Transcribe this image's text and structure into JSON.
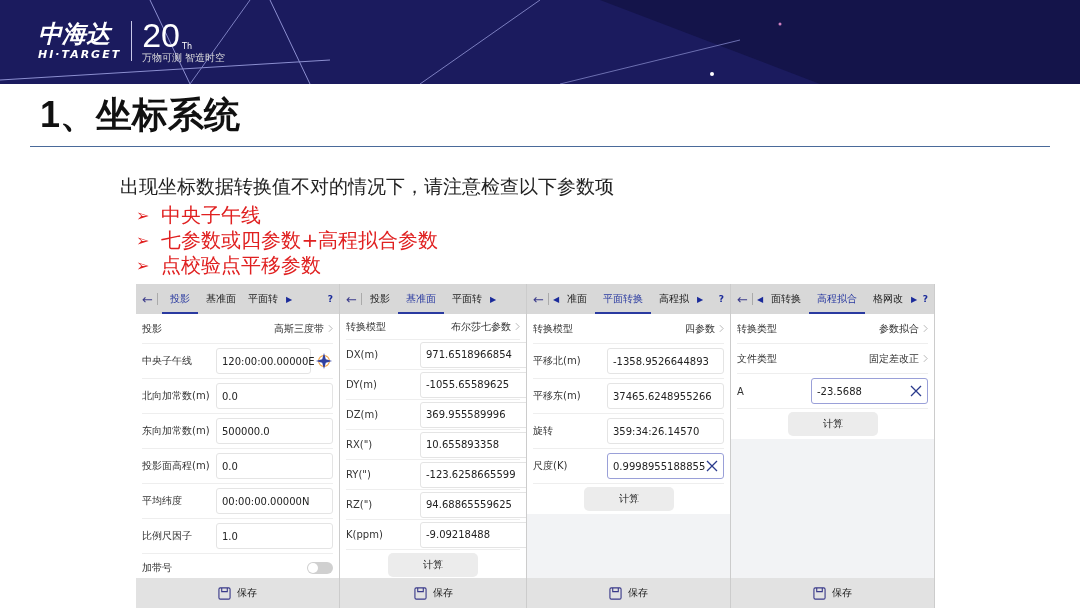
{
  "header": {
    "logo_cn": "中海达",
    "logo_en": "HI·TARGET",
    "anniversary": "20",
    "anniversary_suffix": "Th",
    "slogan": "万物可测 智造时空"
  },
  "title": "1、坐标系统",
  "intro": "出现坐标数据转换值不对的情况下，请注意检查以下参数项",
  "bullets": [
    {
      "marker": "➢",
      "text": "中央子午线"
    },
    {
      "marker": "➢",
      "text": "七参数或四参数+高程拟合参数"
    },
    {
      "marker": "➢",
      "text": "点校验点平移参数"
    }
  ],
  "screens": [
    {
      "back": "←",
      "tabs": [
        {
          "label": "投影",
          "selected": true
        },
        {
          "label": "基准面",
          "selected": false
        },
        {
          "label": "平面转",
          "selected": false
        }
      ],
      "next": "▶",
      "help": "?",
      "rows": [
        {
          "kind": "select",
          "label": "投影",
          "value": "高斯三度带"
        },
        {
          "kind": "field",
          "label": "中央子午线",
          "value": "120:00:00.00000E",
          "focused": false,
          "locate": true
        },
        {
          "kind": "field",
          "label": "北向加常数(m)",
          "value": "0.0",
          "focused": false
        },
        {
          "kind": "field",
          "label": "东向加常数(m)",
          "value": "500000.0",
          "focused": false
        },
        {
          "kind": "field",
          "label": "投影面高程(m)",
          "value": "0.0",
          "focused": false
        },
        {
          "kind": "field",
          "label": "平均纬度",
          "value": "00:00:00.00000N",
          "focused": false
        },
        {
          "kind": "field",
          "label": "比例尺因子",
          "value": "1.0",
          "focused": false
        },
        {
          "kind": "toggle",
          "label": "加带号",
          "on": false
        }
      ],
      "save": "保存"
    },
    {
      "back": "←",
      "tabs": [
        {
          "label": "投影",
          "selected": false
        },
        {
          "label": "基准面",
          "selected": true
        },
        {
          "label": "平面转",
          "selected": false
        }
      ],
      "next": "▶",
      "rows": [
        {
          "kind": "select",
          "label": "转换模型",
          "value": "布尔莎七参数"
        },
        {
          "kind": "field",
          "label": "DX(m)",
          "value": "971.6518966854",
          "focused": false
        },
        {
          "kind": "field",
          "label": "DY(m)",
          "value": "-1055.65589625",
          "focused": false
        },
        {
          "kind": "field",
          "label": "DZ(m)",
          "value": "369.955589996",
          "focused": false
        },
        {
          "kind": "field",
          "label": "RX(\")",
          "value": "10.655893358",
          "focused": false
        },
        {
          "kind": "field",
          "label": "RY(\")",
          "value": "-123.6258665599",
          "focused": false
        },
        {
          "kind": "field",
          "label": "RZ(\")",
          "value": "94.68865559625",
          "focused": false
        },
        {
          "kind": "field",
          "label": "K(ppm)",
          "value": "-9.09218488",
          "focused": false
        }
      ],
      "calc": "计算",
      "save": "保存"
    },
    {
      "back": "←",
      "prev": "◀",
      "tabs": [
        {
          "label": "准面",
          "selected": false
        },
        {
          "label": "平面转换",
          "selected": true
        },
        {
          "label": "高程拟",
          "selected": false
        }
      ],
      "next": "▶",
      "help": "?",
      "rows": [
        {
          "kind": "select",
          "label": "转换模型",
          "value": "四参数"
        },
        {
          "kind": "field",
          "label": "平移北(m)",
          "value": "-1358.9526644893",
          "focused": false
        },
        {
          "kind": "field",
          "label": "平移东(m)",
          "value": "37465.6248955266",
          "focused": false
        },
        {
          "kind": "field",
          "label": "旋转",
          "value": "359:34:26.14570",
          "focused": false
        },
        {
          "kind": "field",
          "label": "尺度(K)",
          "value": "0.9998955188855",
          "focused": true
        }
      ],
      "calc": "计算",
      "save": "保存"
    },
    {
      "back": "←",
      "prev": "◀",
      "tabs": [
        {
          "label": "面转换",
          "selected": false
        },
        {
          "label": "高程拟合",
          "selected": true
        },
        {
          "label": "格网改",
          "selected": false
        }
      ],
      "next": "▶",
      "help": "?",
      "rows": [
        {
          "kind": "select",
          "label": "转换类型",
          "value": "参数拟合"
        },
        {
          "kind": "select",
          "label": "文件类型",
          "value": "固定差改正"
        },
        {
          "kind": "field",
          "label": "A",
          "value": "-23.5688",
          "focused": true
        }
      ],
      "calc": "计算",
      "save": "保存"
    }
  ]
}
